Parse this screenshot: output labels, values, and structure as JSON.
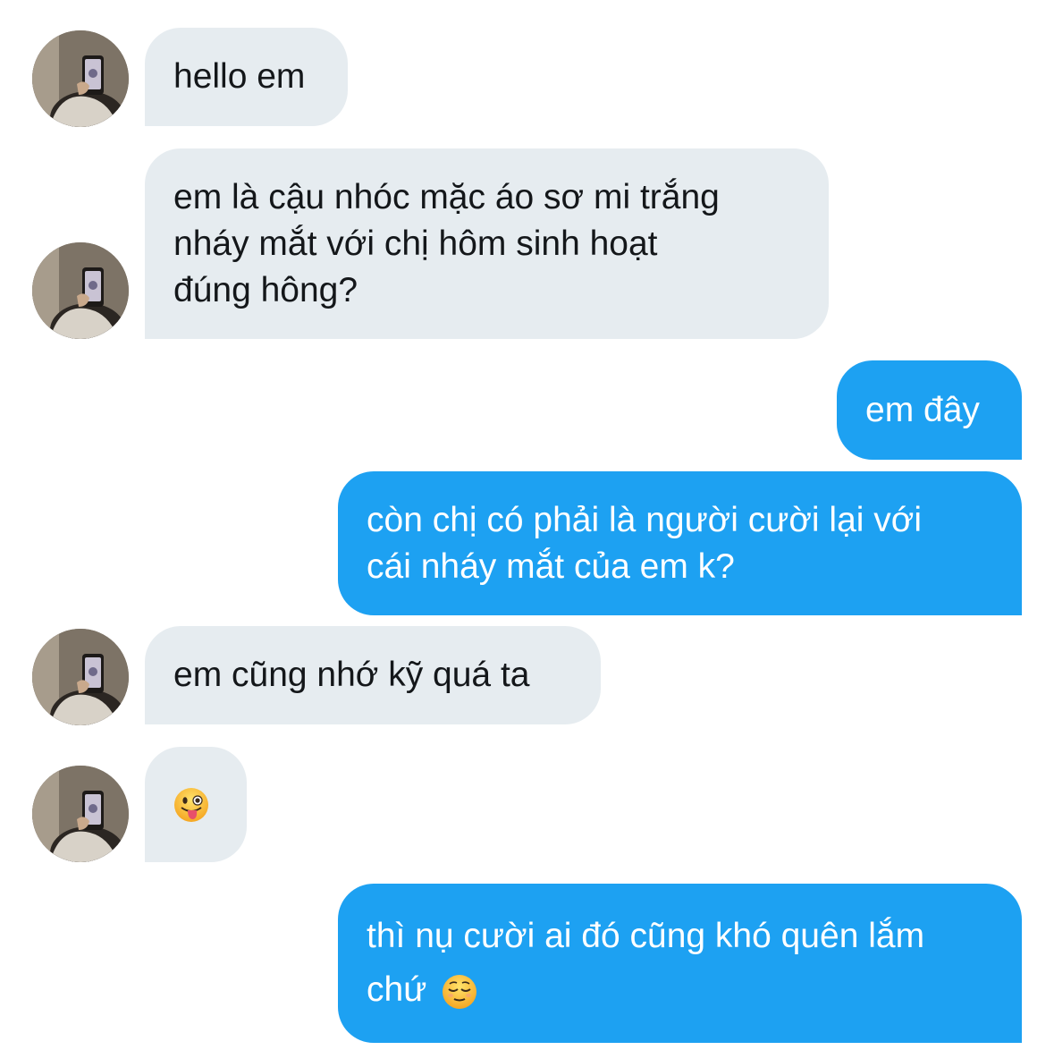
{
  "messages": [
    {
      "from": "other",
      "lines": [
        "hello em"
      ]
    },
    {
      "from": "other",
      "lines": [
        "em là cậu nhóc mặc áo sơ mi trắng",
        "nháy mắt với chị hôm sinh hoạt",
        "đúng hông?"
      ]
    },
    {
      "from": "me",
      "lines": [
        "em đây"
      ]
    },
    {
      "from": "me",
      "lines": [
        "còn chị có phải là người cười lại với",
        "cái nháy mắt của em k?"
      ]
    },
    {
      "from": "other",
      "lines": [
        "em cũng nhớ kỹ quá ta"
      ]
    },
    {
      "from": "other",
      "emoji": "winking-face-with-tongue-emoji"
    },
    {
      "from": "me",
      "lines": [
        "thì nụ cười ai đó cũng khó quên lắm",
        "chứ"
      ],
      "trailing_emoji": "relieved-face-emoji"
    }
  ],
  "colors": {
    "incoming_bubble": "#e6ecf0",
    "outgoing_bubble": "#1da1f2",
    "incoming_text": "#14171a",
    "outgoing_text": "#ffffff"
  }
}
